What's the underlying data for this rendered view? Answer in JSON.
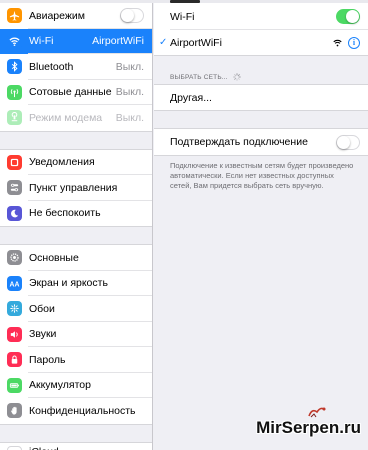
{
  "sidebar": {
    "group1": [
      {
        "label": "Авиарежим",
        "value": "",
        "icon": "airplane-icon",
        "color": "#ff9500"
      },
      {
        "label": "Wi-Fi",
        "value": "AirportWiFi",
        "icon": "wifi-icon",
        "color": "#1a82fb"
      },
      {
        "label": "Bluetooth",
        "value": "Выкл.",
        "icon": "bluetooth-icon",
        "color": "#1a82fb"
      },
      {
        "label": "Сотовые данные",
        "value": "Выкл.",
        "icon": "cellular-icon",
        "color": "#4cd964"
      },
      {
        "label": "Режим модема",
        "value": "Выкл.",
        "icon": "hotspot-icon",
        "color": "#4cd964"
      }
    ],
    "group2": [
      {
        "label": "Уведомления",
        "icon": "notifications-icon",
        "color": "#ff3b30"
      },
      {
        "label": "Пункт управления",
        "icon": "control-center-icon",
        "color": "#8e8e93"
      },
      {
        "label": "Не беспокоить",
        "icon": "moon-icon",
        "color": "#5856d6"
      }
    ],
    "group3": [
      {
        "label": "Основные",
        "icon": "gear-icon",
        "color": "#8e8e93"
      },
      {
        "label": "Экран и яркость",
        "icon": "brightness-icon",
        "color": "#1a82fb"
      },
      {
        "label": "Обои",
        "icon": "wallpaper-icon",
        "color": "#34aadc"
      },
      {
        "label": "Звуки",
        "icon": "sounds-icon",
        "color": "#ff2d55"
      },
      {
        "label": "Пароль",
        "icon": "lock-icon",
        "color": "#ff2d55"
      },
      {
        "label": "Аккумулятор",
        "icon": "battery-icon",
        "color": "#4cd964"
      },
      {
        "label": "Конфиденциальность",
        "icon": "hand-icon",
        "color": "#8e8e93"
      }
    ],
    "group4": [
      {
        "label": "iCloud",
        "icon": "icloud-icon",
        "color": "#ffffff"
      }
    ]
  },
  "wifi_panel": {
    "wifi_label": "Wi-Fi",
    "wifi_on": true,
    "connected_network": "AirportWiFi",
    "choose_network_header": "ВЫБРАТЬ СЕТЬ...",
    "other_label": "Другая...",
    "ask_to_join_label": "Подтверждать подключение",
    "ask_to_join_on": false,
    "ask_to_join_note": "Подключение к известным сетям будет произведено автоматически. Если нет известных доступных сетей, Вам придется выбрать сеть вручную."
  },
  "watermark": {
    "text": "MirSerpen.ru"
  }
}
